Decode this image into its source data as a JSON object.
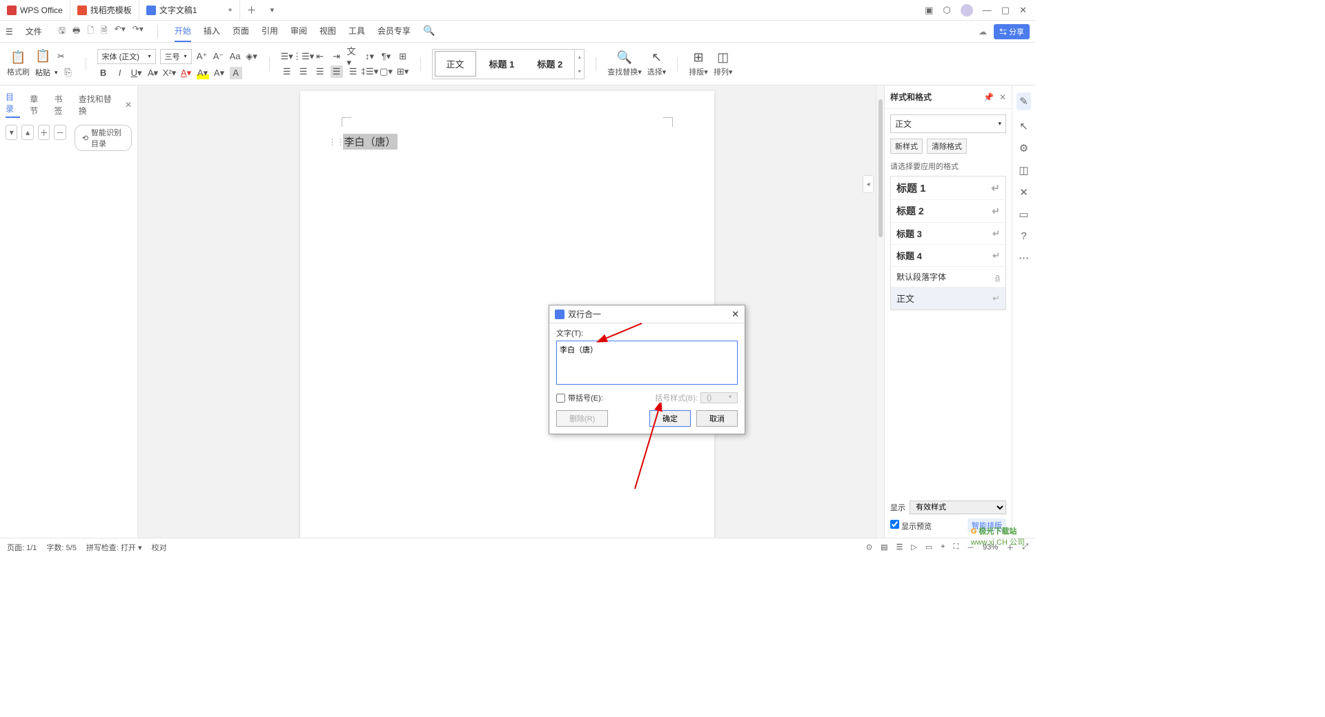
{
  "titlebar": {
    "app_name": "WPS Office",
    "tab_template": "找稻壳模板",
    "tab_doc": "文字文稿1"
  },
  "menubar": {
    "file": "文件",
    "tabs": [
      "开始",
      "插入",
      "页面",
      "引用",
      "审阅",
      "视图",
      "工具",
      "会员专享"
    ],
    "share": "⇆ 分享"
  },
  "ribbon": {
    "format_brush": "格式刷",
    "paste": "粘贴",
    "font_name": "宋体 (正文)",
    "font_size": "三号",
    "style_body": "正文",
    "style_h1": "标题 1",
    "style_h2": "标题 2",
    "find_replace": "查找替换",
    "select": "选择",
    "layout": "排版",
    "arrange": "排列"
  },
  "nav": {
    "tabs": [
      "目录",
      "章节",
      "书签",
      "查找和替换"
    ],
    "smart": "智能识别目录"
  },
  "document": {
    "text": "李白（唐）"
  },
  "dialog": {
    "title": "双行合一",
    "text_label": "文字(T):",
    "text_value": "李白（唐）",
    "bracket": "带括号(E):",
    "bracket_style": "括号样式(B):",
    "bracket_opt": "()",
    "delete": "删除(R)",
    "ok": "确定",
    "cancel": "取消"
  },
  "right_panel": {
    "title": "样式和格式",
    "current": "正文",
    "new_style": "新样式",
    "clear": "清除格式",
    "hint": "请选择要应用的格式",
    "items": [
      "标题 1",
      "标题 2",
      "标题 3",
      "标题 4",
      "默认段落字体",
      "正文"
    ],
    "show": "显示",
    "show_val": "有效样式",
    "preview": "显示预览",
    "auto": "智能排版"
  },
  "status": {
    "page": "页面: 1/1",
    "words": "字数: 5/5",
    "spell": "拼写检查: 打开",
    "proof": "校对",
    "zoom": "93%"
  },
  "watermark": {
    "site": "www.xi CH 公司",
    "brand": "极光下载站"
  }
}
